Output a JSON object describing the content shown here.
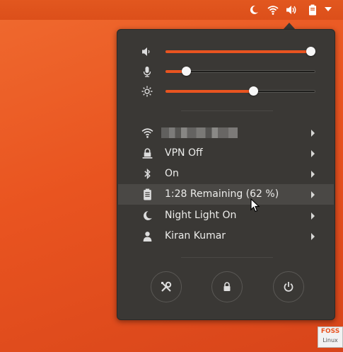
{
  "topbar": {
    "icons": [
      "night-light-icon",
      "wifi-icon",
      "volume-icon",
      "battery-icon",
      "system-menu-arrow-icon"
    ]
  },
  "sliders": {
    "volume": {
      "icon": "speaker-icon",
      "level": 0.97
    },
    "microphone": {
      "icon": "microphone-icon",
      "level": 0.14
    },
    "brightness": {
      "icon": "brightness-icon",
      "level": 0.59
    }
  },
  "menu": {
    "items": [
      {
        "name": "wifi",
        "icon": "wifi-icon",
        "label": ""
      },
      {
        "name": "vpn",
        "icon": "vpn-icon",
        "label": "VPN Off"
      },
      {
        "name": "bluetooth",
        "icon": "bluetooth-icon",
        "label": "On"
      },
      {
        "name": "battery",
        "icon": "battery-icon",
        "label": "1:28 Remaining (62 %)"
      },
      {
        "name": "night-light",
        "icon": "night-light-icon",
        "label": "Night Light On"
      },
      {
        "name": "user",
        "icon": "user-icon",
        "label": "Kiran Kumar"
      }
    ]
  },
  "actions": [
    "settings-icon",
    "lock-icon",
    "power-icon"
  ],
  "watermark": {
    "line1": "FOSS",
    "line2": "Linux"
  },
  "colors": {
    "accent": "#e95420",
    "menu_bg": "#3a3835",
    "text": "#ececea"
  }
}
